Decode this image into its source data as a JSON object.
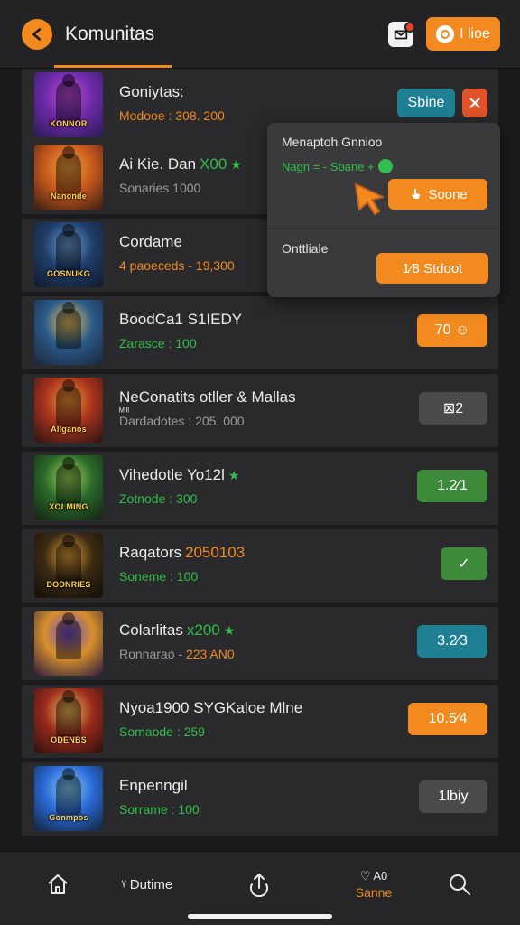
{
  "header": {
    "title": "Komunitas",
    "action_label": "I lioe",
    "back_icon": "back-arrow-icon",
    "inbox_icon": "inbox-icon"
  },
  "items": [
    {
      "title": "Goniytas:",
      "title_accent": "",
      "title_star": "",
      "extra": "",
      "sub_label": "Modooe : ",
      "sub_value": "308. 200",
      "logo": "KONNOR",
      "btn": "Sbine",
      "btn_color": "#1f7f93",
      "btn2": "x",
      "thumb_colors": [
        "#6d2aa8",
        "#c04cd9",
        "#2a1b55"
      ]
    },
    {
      "title": "Ai Kie. Dan",
      "title_accent": "X00",
      "title_star": "★",
      "extra": "",
      "sub_label": "Sonaries ",
      "sub_value": "1000",
      "logo": "Nanonde",
      "btn": "",
      "btn_color": "",
      "thumb_colors": [
        "#c8591d",
        "#f2a43a",
        "#3a1d12"
      ]
    },
    {
      "title": "Cordame",
      "title_accent": "",
      "title_star": "",
      "extra": "",
      "sub_label": "4 paoeceds - ",
      "sub_value": "19,300",
      "logo": "GOSNUKG",
      "btn": "",
      "btn_color": "",
      "thumb_colors": [
        "#1f3e6a",
        "#6fa1d8",
        "#111a2a"
      ]
    },
    {
      "title": "BoodCa1 S1IEDY",
      "title_accent": "",
      "title_star": "",
      "extra": "",
      "sub_label": "Zarasce : ",
      "sub_value": "100",
      "logo": "",
      "btn": "70 ☺",
      "btn_color": "#f28a1f",
      "thumb_colors": [
        "#2a5a8a",
        "#f0c45a",
        "#1a2538"
      ]
    },
    {
      "title": "NeConatits otller & Mallas",
      "title_accent": "",
      "title_star": "",
      "extra": "ᴹᴵᴵᴵ",
      "sub_label": "Dardadotes : ",
      "sub_value": "205. 000",
      "logo": "Allganos",
      "btn": "⊠2",
      "btn_color": "#4a4a4c",
      "thumb_colors": [
        "#a8321d",
        "#f29a3a",
        "#2a1511"
      ]
    },
    {
      "title": "Vihedotle Yo12l",
      "title_accent": "",
      "title_star": "★",
      "extra": "",
      "sub_label": "Zotnode : ",
      "sub_value": "300",
      "logo": "XOLMING",
      "btn": "1.2⁄1",
      "btn_color": "#3d8a3b",
      "thumb_colors": [
        "#2a6a2a",
        "#a6d85a",
        "#142114"
      ]
    },
    {
      "title": "Raqators",
      "title_accent": "2050103",
      "title_star": "",
      "extra": "",
      "sub_label": "Soneme : ",
      "sub_value": "100",
      "logo": "DODNRIES",
      "btn": "✓",
      "btn_color": "#3d8a3b",
      "thumb_colors": [
        "#3a2a12",
        "#e7a33a",
        "#120d08"
      ]
    },
    {
      "title": "Colarlitas",
      "title_accent": "x200",
      "title_star": "★",
      "extra": "",
      "sub_label": "Ronnarao - ",
      "sub_value": "223 AN0",
      "logo": "",
      "btn": "3.2⁄3",
      "btn_color": "#1f7f93",
      "thumb_colors": [
        "#d8902a",
        "#6a4ad8",
        "#2a1a40"
      ]
    },
    {
      "title": "Nyoa1900 SYGKaloe Mlne",
      "title_accent": "",
      "title_star": "",
      "extra": "",
      "sub_label": "Somaode : ",
      "sub_value": "259",
      "logo": "ODENBS",
      "btn": "10.5⁄4",
      "btn_color": "#f28a1f",
      "thumb_colors": [
        "#9a2a1d",
        "#f2c35a",
        "#2a100d"
      ]
    },
    {
      "title": "Enpenngil",
      "title_accent": "",
      "title_star": "",
      "extra": "",
      "sub_label": "Sorrame : ",
      "sub_value": "100",
      "logo": "Gonmpos",
      "btn": "1lbiy",
      "btn_color": "#4a4a4c",
      "thumb_colors": [
        "#2a6ad8",
        "#8ad2f2",
        "#12223a"
      ]
    }
  ],
  "popover": {
    "header": "Menaptoh Gnnioo",
    "status": "Nagn = - Sbane +",
    "btn1": "Soone",
    "label2": "Onttliale",
    "btn2": "1⁄8 Stdoot"
  },
  "bottom_nav": {
    "items": [
      {
        "icon": "home-icon",
        "label": ""
      },
      {
        "icon": "",
        "label": "ᵞ Dutime"
      },
      {
        "icon": "share-icon",
        "label": ""
      },
      {
        "icon": "notification-icon",
        "label_top": "♡ A0",
        "label": "Sanne"
      },
      {
        "icon": "search-icon",
        "label": ""
      }
    ]
  },
  "colors": {
    "accent": "#f28a1f",
    "green": "#2fbf4a",
    "teal": "#1f7f93",
    "danger": "#e0532b"
  }
}
